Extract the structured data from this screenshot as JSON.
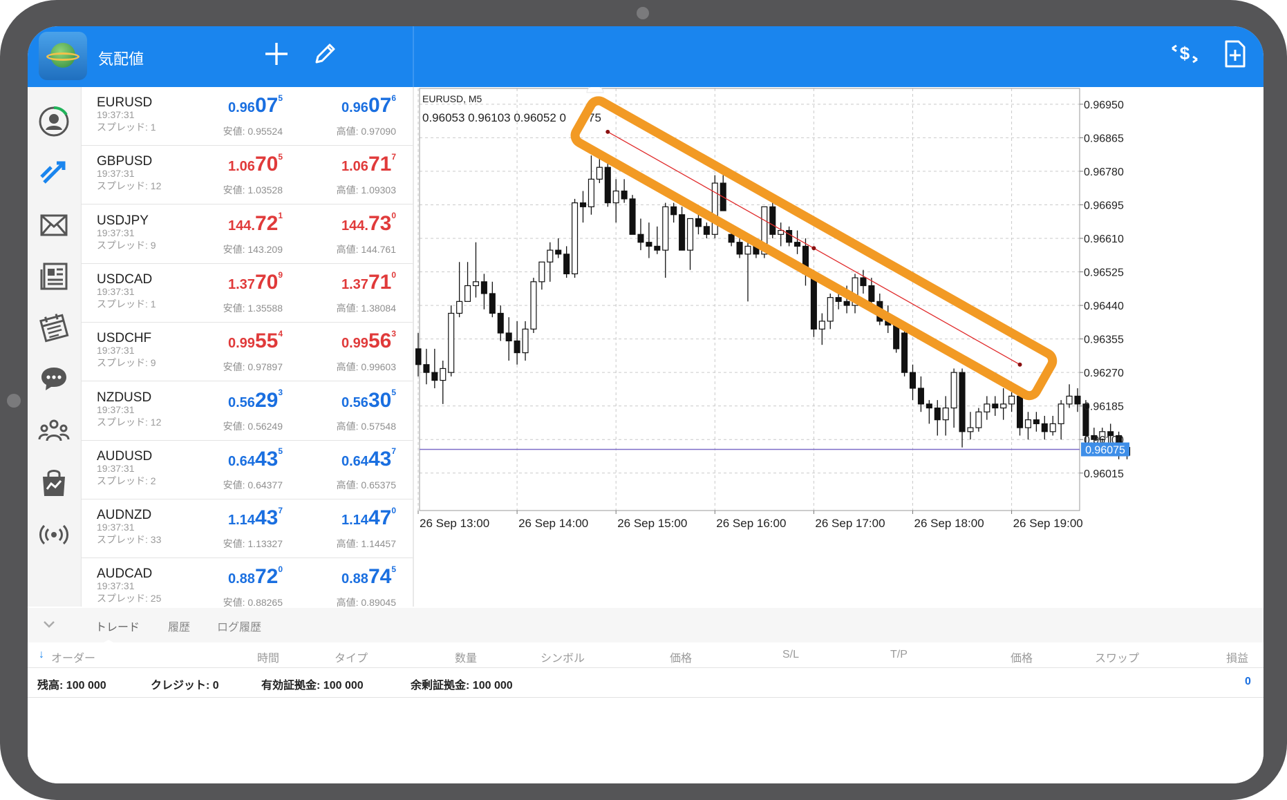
{
  "header": {
    "title": "気配値"
  },
  "quotes": [
    {
      "symbol": "EURUSD",
      "time": "19:37:31",
      "spread": "スプレッド: 1",
      "color": "blue",
      "bid": {
        "pre": "0.96",
        "big": "07",
        "sup": "5"
      },
      "ask": {
        "pre": "0.96",
        "big": "07",
        "sup": "6"
      },
      "low": "安値: 0.95524",
      "high": "高値: 0.97090"
    },
    {
      "symbol": "GBPUSD",
      "time": "19:37:31",
      "spread": "スプレッド: 12",
      "color": "red",
      "bid": {
        "pre": "1.06",
        "big": "70",
        "sup": "5"
      },
      "ask": {
        "pre": "1.06",
        "big": "71",
        "sup": "7"
      },
      "low": "安値: 1.03528",
      "high": "高値: 1.09303"
    },
    {
      "symbol": "USDJPY",
      "time": "19:37:31",
      "spread": "スプレッド: 9",
      "color": "red",
      "bid": {
        "pre": "144.",
        "big": "72",
        "sup": "1"
      },
      "ask": {
        "pre": "144.",
        "big": "73",
        "sup": "0"
      },
      "low": "安値: 143.209",
      "high": "高値: 144.761"
    },
    {
      "symbol": "USDCAD",
      "time": "19:37:31",
      "spread": "スプレッド: 1",
      "color": "red",
      "bid": {
        "pre": "1.37",
        "big": "70",
        "sup": "9"
      },
      "ask": {
        "pre": "1.37",
        "big": "71",
        "sup": "0"
      },
      "low": "安値: 1.35588",
      "high": "高値: 1.38084"
    },
    {
      "symbol": "USDCHF",
      "time": "19:37:31",
      "spread": "スプレッド: 9",
      "color": "red",
      "bid": {
        "pre": "0.99",
        "big": "55",
        "sup": "4"
      },
      "ask": {
        "pre": "0.99",
        "big": "56",
        "sup": "3"
      },
      "low": "安値: 0.97897",
      "high": "高値: 0.99603"
    },
    {
      "symbol": "NZDUSD",
      "time": "19:37:31",
      "spread": "スプレッド: 12",
      "color": "blue",
      "bid": {
        "pre": "0.56",
        "big": "29",
        "sup": "3"
      },
      "ask": {
        "pre": "0.56",
        "big": "30",
        "sup": "5"
      },
      "low": "安値: 0.56249",
      "high": "高値: 0.57548"
    },
    {
      "symbol": "AUDUSD",
      "time": "19:37:31",
      "spread": "スプレッド: 2",
      "color": "blue",
      "bid": {
        "pre": "0.64",
        "big": "43",
        "sup": "5"
      },
      "ask": {
        "pre": "0.64",
        "big": "43",
        "sup": "7"
      },
      "low": "安値: 0.64377",
      "high": "高値: 0.65375"
    },
    {
      "symbol": "AUDNZD",
      "time": "19:37:31",
      "spread": "スプレッド: 33",
      "color": "blue",
      "bid": {
        "pre": "1.14",
        "big": "43",
        "sup": "7"
      },
      "ask": {
        "pre": "1.14",
        "big": "47",
        "sup": "0"
      },
      "low": "安値: 1.13327",
      "high": "高値: 1.14457"
    },
    {
      "symbol": "AUDCAD",
      "time": "19:37:31",
      "spread": "スプレッド: 25",
      "color": "blue",
      "bid": {
        "pre": "0.88",
        "big": "72",
        "sup": "0"
      },
      "ask": {
        "pre": "0.88",
        "big": "74",
        "sup": "5"
      },
      "low": "安値: 0.88265",
      "high": "高値: 0.89045"
    }
  ],
  "chart": {
    "symbol_label": "EURUSD, M5",
    "ohlc_label": "0.96053 0.96103 0.96052 0",
    "ohlc_tail": "75",
    "price_ticks": [
      "0.96950",
      "0.96865",
      "0.96780",
      "0.96695",
      "0.96610",
      "0.96525",
      "0.96440",
      "0.96355",
      "0.96270",
      "0.96185",
      "0.96100",
      "0.96015"
    ],
    "current_price": "0.96075",
    "time_ticks": [
      "26 Sep 13:00",
      "26 Sep 14:00",
      "26 Sep 15:00",
      "26 Sep 16:00",
      "26 Sep 17:00",
      "26 Sep 18:00",
      "26 Sep 19:00"
    ],
    "accent_color": "#f29a24",
    "trendline_color": "#e02b2b",
    "price_line_color": "#7b6bc8",
    "trendline": {
      "from": {
        "time": "26 Sep 14:55",
        "price": 0.9688
      },
      "to": {
        "time": "26 Sep 19:05",
        "price": 0.9629
      }
    }
  },
  "chart_data": {
    "type": "candlestick",
    "series_name": "EURUSD, M5",
    "y_range": [
      0.9592,
      0.9699
    ],
    "x_start": "26 Sep 12:50",
    "x_step": "5 min",
    "candles": [
      [
        0.9642,
        0.9644,
        0.9636,
        0.9639
      ],
      [
        0.9639,
        0.96415,
        0.9631,
        0.9633
      ],
      [
        0.9633,
        0.9637,
        0.9626,
        0.9629
      ],
      [
        0.9629,
        0.9633,
        0.9624,
        0.9627
      ],
      [
        0.9627,
        0.9633,
        0.9623,
        0.9625
      ],
      [
        0.9625,
        0.963,
        0.9619,
        0.9628
      ],
      [
        0.9627,
        0.9644,
        0.9626,
        0.9642
      ],
      [
        0.9642,
        0.9655,
        0.9641,
        0.9645
      ],
      [
        0.9645,
        0.9655,
        0.9645,
        0.9649
      ],
      [
        0.9649,
        0.966,
        0.9646,
        0.965
      ],
      [
        0.965,
        0.9652,
        0.9643,
        0.9647
      ],
      [
        0.9647,
        0.965,
        0.9641,
        0.9642
      ],
      [
        0.9642,
        0.9644,
        0.9635,
        0.9637
      ],
      [
        0.9637,
        0.9641,
        0.963,
        0.9635
      ],
      [
        0.9635,
        0.964,
        0.9629,
        0.9632
      ],
      [
        0.9632,
        0.964,
        0.963,
        0.9638
      ],
      [
        0.9638,
        0.9651,
        0.9637,
        0.965
      ],
      [
        0.965,
        0.9655,
        0.9648,
        0.9655
      ],
      [
        0.9655,
        0.966,
        0.965,
        0.9658
      ],
      [
        0.9658,
        0.9661,
        0.9656,
        0.9657
      ],
      [
        0.9657,
        0.9659,
        0.9651,
        0.9652
      ],
      [
        0.9652,
        0.9671,
        0.9651,
        0.967
      ],
      [
        0.967,
        0.9673,
        0.9665,
        0.9669
      ],
      [
        0.9669,
        0.9682,
        0.9667,
        0.9676
      ],
      [
        0.9676,
        0.9683,
        0.9675,
        0.9679
      ],
      [
        0.9679,
        0.968,
        0.9669,
        0.967
      ],
      [
        0.967,
        0.9676,
        0.9665,
        0.9673
      ],
      [
        0.9673,
        0.9676,
        0.967,
        0.9671
      ],
      [
        0.9671,
        0.9672,
        0.9662,
        0.9662
      ],
      [
        0.9662,
        0.9666,
        0.9658,
        0.966
      ],
      [
        0.966,
        0.9665,
        0.9656,
        0.9659
      ],
      [
        0.9659,
        0.9664,
        0.9657,
        0.9658
      ],
      [
        0.9658,
        0.967,
        0.9651,
        0.9669
      ],
      [
        0.9669,
        0.967,
        0.9665,
        0.9667
      ],
      [
        0.9667,
        0.9669,
        0.9658,
        0.9658
      ],
      [
        0.9658,
        0.9666,
        0.9653,
        0.9666
      ],
      [
        0.9666,
        0.9668,
        0.9662,
        0.9664
      ],
      [
        0.9664,
        0.9665,
        0.9661,
        0.9662
      ],
      [
        0.9662,
        0.9677,
        0.9661,
        0.9675
      ],
      [
        0.9675,
        0.9677,
        0.9668,
        0.9668
      ],
      [
        0.9662,
        0.9664,
        0.9659,
        0.966
      ],
      [
        0.966,
        0.9662,
        0.9656,
        0.9657
      ],
      [
        0.9657,
        0.966,
        0.9645,
        0.9659
      ],
      [
        0.9659,
        0.966,
        0.9656,
        0.9657
      ],
      [
        0.9657,
        0.9668,
        0.9656,
        0.9669
      ],
      [
        0.9669,
        0.967,
        0.9661,
        0.9662
      ],
      [
        0.9662,
        0.9665,
        0.9659,
        0.9663
      ],
      [
        0.9663,
        0.9664,
        0.9659,
        0.966
      ],
      [
        0.966,
        0.9663,
        0.9657,
        0.9659
      ],
      [
        0.9659,
        0.9661,
        0.9649,
        0.9652
      ],
      [
        0.9652,
        0.9653,
        0.9636,
        0.9638
      ],
      [
        0.9638,
        0.9642,
        0.9634,
        0.964
      ],
      [
        0.964,
        0.9647,
        0.9638,
        0.9646
      ],
      [
        0.9646,
        0.9648,
        0.9643,
        0.9645
      ],
      [
        0.9645,
        0.9649,
        0.9642,
        0.9644
      ],
      [
        0.9644,
        0.9652,
        0.9642,
        0.9651
      ],
      [
        0.9651,
        0.9653,
        0.9647,
        0.9649
      ],
      [
        0.9649,
        0.9651,
        0.9644,
        0.9645
      ],
      [
        0.9645,
        0.9647,
        0.9639,
        0.964
      ],
      [
        0.964,
        0.9644,
        0.9637,
        0.9639
      ],
      [
        0.9639,
        0.9641,
        0.9632,
        0.9633
      ],
      [
        0.9637,
        0.9638,
        0.9626,
        0.9627
      ],
      [
        0.9627,
        0.9629,
        0.962,
        0.9623
      ],
      [
        0.9623,
        0.9626,
        0.9617,
        0.9619
      ],
      [
        0.9619,
        0.962,
        0.9614,
        0.9618
      ],
      [
        0.9618,
        0.962,
        0.9611,
        0.9615
      ],
      [
        0.9615,
        0.9621,
        0.9611,
        0.9618
      ],
      [
        0.9618,
        0.9628,
        0.9613,
        0.9627
      ],
      [
        0.9627,
        0.9628,
        0.9608,
        0.9612
      ],
      [
        0.9612,
        0.9617,
        0.961,
        0.9613
      ],
      [
        0.9613,
        0.9618,
        0.9612,
        0.9617
      ],
      [
        0.9617,
        0.9621,
        0.9615,
        0.9619
      ],
      [
        0.9619,
        0.9621,
        0.9616,
        0.9618
      ],
      [
        0.9618,
        0.9623,
        0.9615,
        0.9619
      ],
      [
        0.9619,
        0.9622,
        0.9617,
        0.9621
      ],
      [
        0.9621,
        0.9623,
        0.9611,
        0.9613
      ],
      [
        0.9613,
        0.9617,
        0.961,
        0.9615
      ],
      [
        0.9615,
        0.9617,
        0.9612,
        0.9614
      ],
      [
        0.9614,
        0.9616,
        0.961,
        0.9612
      ],
      [
        0.9612,
        0.9616,
        0.9611,
        0.9614
      ],
      [
        0.9614,
        0.962,
        0.961,
        0.9619
      ],
      [
        0.9619,
        0.9624,
        0.9618,
        0.9621
      ],
      [
        0.9621,
        0.9623,
        0.9617,
        0.9619
      ],
      [
        0.9619,
        0.962,
        0.9609,
        0.9611
      ],
      [
        0.9611,
        0.9613,
        0.9608,
        0.961
      ],
      [
        0.961,
        0.9613,
        0.9609,
        0.9612
      ],
      [
        0.9612,
        0.9614,
        0.9609,
        0.9611
      ],
      [
        0.9611,
        0.9612,
        0.9605,
        0.9606
      ],
      [
        0.9606,
        0.9609,
        0.9605,
        0.9608
      ]
    ]
  },
  "terminal": {
    "tabs": [
      "トレード",
      "履歴",
      "ログ履歴"
    ],
    "columns": [
      "オーダー",
      "時間",
      "タイプ",
      "数量",
      "シンボル",
      "価格",
      "S/L",
      "T/P",
      "価格",
      "スワップ",
      "損益"
    ],
    "summary": [
      {
        "label": "残高:",
        "value": "100 000"
      },
      {
        "label": "クレジット:",
        "value": "0"
      },
      {
        "label": "有効証拠金:",
        "value": "100 000"
      },
      {
        "label": "余剰証拠金:",
        "value": "100 000"
      }
    ],
    "profit": "0"
  }
}
